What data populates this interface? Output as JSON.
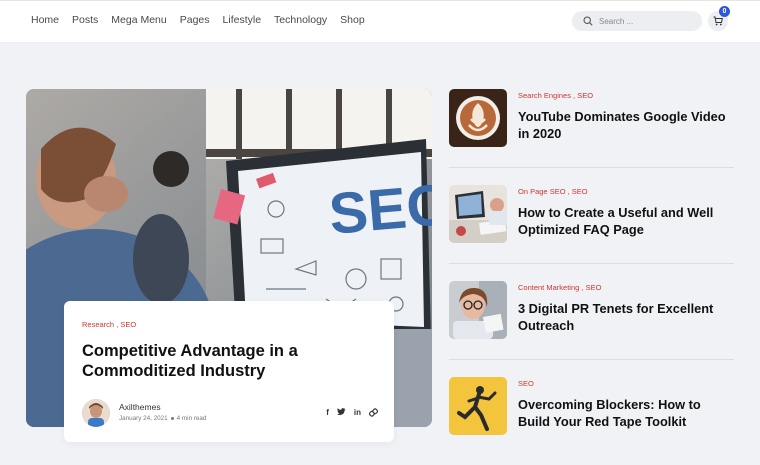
{
  "nav": {
    "items": [
      "Home",
      "Posts",
      "Mega Menu",
      "Pages",
      "Lifestyle",
      "Technology",
      "Shop"
    ]
  },
  "search": {
    "placeholder": "Search ..."
  },
  "cart": {
    "count": "0"
  },
  "featured": {
    "image_icon": "seo-workspace-photo",
    "categories": [
      "Research",
      "SEO"
    ],
    "title": "Competitive Advantage in a Commoditized Industry",
    "author": "Axilthemes",
    "date": "January 24, 2021",
    "read_time": "4 min read",
    "share_icons": [
      "facebook-icon",
      "twitter-icon",
      "linkedin-icon",
      "link-icon"
    ]
  },
  "posts": [
    {
      "categories": [
        "Search Engines",
        "SEO"
      ],
      "title": "YouTube Dominates Google Video in 2020",
      "thumb_icon": "latte-art-photo"
    },
    {
      "categories": [
        "On Page SEO",
        "SEO"
      ],
      "title": "How to Create a Useful and Well Optimized FAQ Page",
      "thumb_icon": "desk-laptop-photo"
    },
    {
      "categories": [
        "Content Marketing",
        "SEO"
      ],
      "title": "3 Digital PR Tenets for Excellent Outreach",
      "thumb_icon": "woman-glasses-photo"
    },
    {
      "categories": [
        "SEO"
      ],
      "title": "Overcoming Blockers: How to Build Your Red Tape Toolkit",
      "thumb_icon": "runner-yellow-photo"
    }
  ],
  "colors": {
    "accent": "#d1362e",
    "badge": "#2c58d8",
    "background": "#f0f2f5"
  }
}
